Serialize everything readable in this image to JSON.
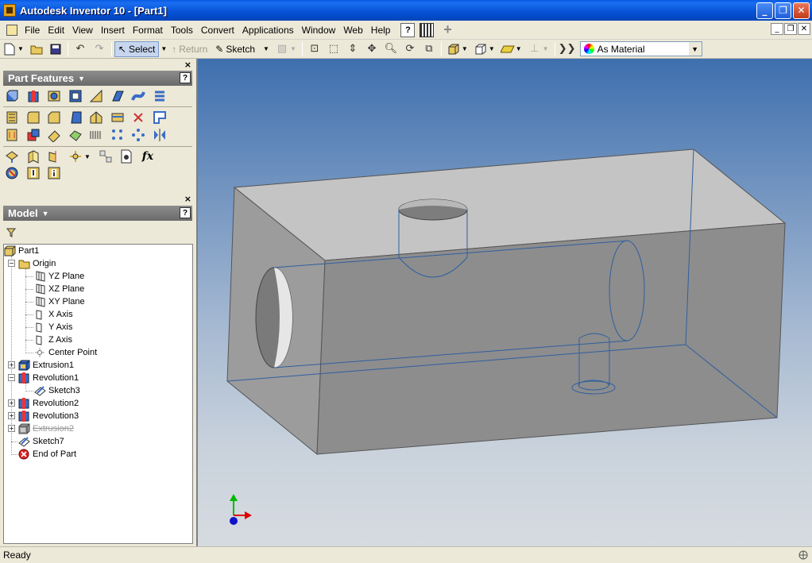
{
  "window": {
    "title": "Autodesk Inventor 10 - [Part1]",
    "minimize": "_",
    "maximize": "❐",
    "close": "✕"
  },
  "menu": {
    "items": [
      "File",
      "Edit",
      "View",
      "Insert",
      "Format",
      "Tools",
      "Convert",
      "Applications",
      "Window",
      "Web",
      "Help"
    ],
    "mdi_minimize": "_",
    "mdi_restore": "❐",
    "mdi_close": "✕"
  },
  "toolbar": {
    "select_label": "Select",
    "return_label": "Return",
    "sketch_label": "Sketch",
    "material": "As Material"
  },
  "panels": {
    "features_title": "Part Features",
    "model_title": "Model",
    "help_glyph": "?",
    "close_glyph": "×",
    "fx_label": "fx"
  },
  "tree": {
    "root": "Part1",
    "origin": "Origin",
    "origin_children": [
      "YZ Plane",
      "XZ Plane",
      "XY Plane",
      "X Axis",
      "Y Axis",
      "Z Axis",
      "Center Point"
    ],
    "features": [
      {
        "label": "Extrusion1",
        "icon": "extrusion-icon"
      },
      {
        "label": "Revolution1",
        "icon": "revolution-icon"
      },
      {
        "label": "Sketch3",
        "icon": "sketch-icon"
      },
      {
        "label": "Revolution2",
        "icon": "revolution-icon"
      },
      {
        "label": "Revolution3",
        "icon": "revolution-icon"
      },
      {
        "label": "Extrusion2",
        "icon": "extrusion-icon",
        "suppressed": true
      },
      {
        "label": "Sketch7",
        "icon": "sketch-icon"
      },
      {
        "label": "End of Part",
        "icon": "end-of-part-icon"
      }
    ]
  },
  "status": {
    "text": "Ready"
  },
  "colors": {
    "titlebar": "#0551d6",
    "panel_header": "#7a7a7a",
    "viewport_top": "#3e6fae",
    "viewport_bottom": "#d6dbe0",
    "model_face_top": "#c2c2c2",
    "model_face_front": "#8c8c8c",
    "model_face_side": "#a5a5a5",
    "edge_lines": "#2f5f9f"
  }
}
